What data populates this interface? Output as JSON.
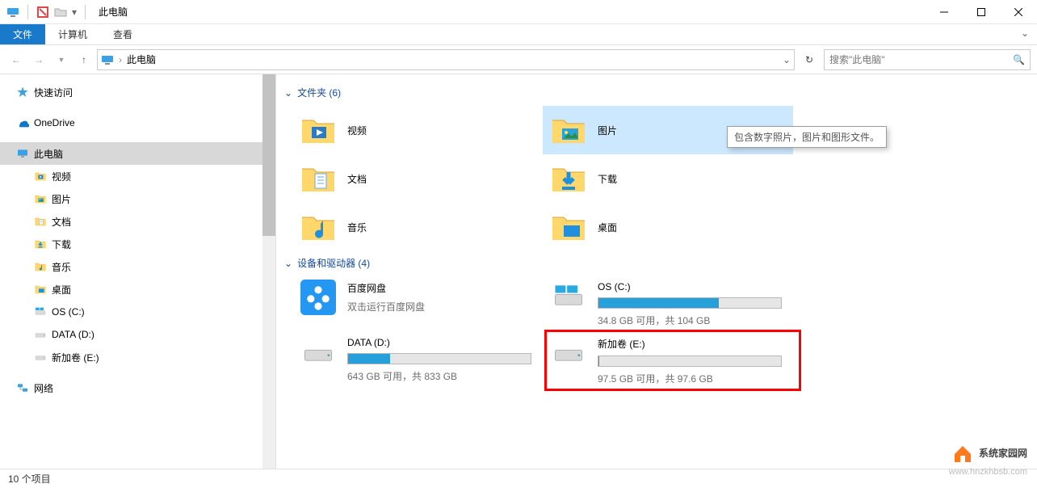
{
  "window": {
    "title": "此电脑"
  },
  "ribbon": {
    "tabs": [
      {
        "label": "文件",
        "active": true
      },
      {
        "label": "计算机",
        "active": false
      },
      {
        "label": "查看",
        "active": false
      }
    ]
  },
  "address": {
    "crumb": "此电脑"
  },
  "search": {
    "placeholder": "搜索\"此电脑\""
  },
  "sidebar": {
    "items": [
      {
        "label": "快速访问",
        "icon": "star",
        "indent": 0
      },
      {
        "label": "OneDrive",
        "icon": "onedrive",
        "indent": 0
      },
      {
        "label": "此电脑",
        "icon": "pc",
        "indent": 0,
        "selected": true
      },
      {
        "label": "视频",
        "icon": "videos",
        "indent": 1
      },
      {
        "label": "图片",
        "icon": "pictures",
        "indent": 1
      },
      {
        "label": "文档",
        "icon": "documents",
        "indent": 1
      },
      {
        "label": "下载",
        "icon": "downloads",
        "indent": 1
      },
      {
        "label": "音乐",
        "icon": "music",
        "indent": 1
      },
      {
        "label": "桌面",
        "icon": "desktop",
        "indent": 1
      },
      {
        "label": "OS (C:)",
        "icon": "drive-win",
        "indent": 1
      },
      {
        "label": "DATA (D:)",
        "icon": "drive",
        "indent": 1
      },
      {
        "label": "新加卷 (E:)",
        "icon": "drive",
        "indent": 1
      },
      {
        "label": "网络",
        "icon": "network",
        "indent": 0
      }
    ]
  },
  "groups": {
    "folders": {
      "title": "文件夹 (6)"
    },
    "devices": {
      "title": "设备和驱动器 (4)"
    }
  },
  "folders": [
    {
      "label": "视频",
      "icon": "videos"
    },
    {
      "label": "图片",
      "icon": "pictures",
      "selected": true
    },
    {
      "label": "文档",
      "icon": "documents"
    },
    {
      "label": "下载",
      "icon": "downloads"
    },
    {
      "label": "音乐",
      "icon": "music"
    },
    {
      "label": "桌面",
      "icon": "desktop"
    }
  ],
  "tooltip": "包含数字照片，图片和图形文件。",
  "devices": [
    {
      "name": "百度网盘",
      "sub": "双击运行百度网盘",
      "type": "app"
    },
    {
      "name": "OS (C:)",
      "free_text": "34.8 GB 可用，共 104 GB",
      "fill_pct": 66,
      "type": "os"
    },
    {
      "name": "DATA (D:)",
      "free_text": "643 GB 可用，共 833 GB",
      "fill_pct": 23,
      "type": "drive"
    },
    {
      "name": "新加卷 (E:)",
      "free_text": "97.5 GB 可用，共 97.6 GB",
      "fill_pct": 0.2,
      "type": "drive",
      "highlighted": true
    }
  ],
  "status": {
    "count_text": "10 个项目"
  },
  "watermark": {
    "brand": "系统家园网",
    "url": "www.hnzkhbsb.com"
  }
}
